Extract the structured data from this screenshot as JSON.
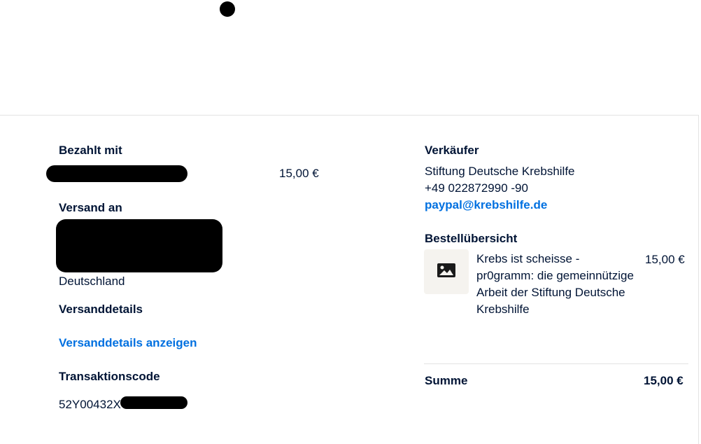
{
  "payment": {
    "heading": "Bezahlt mit",
    "amount": "15,00 €"
  },
  "shipping": {
    "heading": "Versand an",
    "country": "Deutschland"
  },
  "shipping_details": {
    "heading": "Versanddetails",
    "link_label": "Versanddetails anzeigen"
  },
  "transaction": {
    "heading": "Transaktionscode",
    "code_visible": "52Y00432X"
  },
  "seller": {
    "heading": "Verkäufer",
    "name": "Stiftung Deutsche Krebshilfe",
    "phone": "+49 022872990 -90",
    "email": "paypal@krebshilfe.de"
  },
  "order": {
    "heading": "Bestellübersicht",
    "item_image_icon": "image-placeholder-icon",
    "item_description": "Krebs ist scheisse - pr0gramm: die gemeinnützige Arbeit der Stiftung Deutsche Krebshilfe",
    "item_price": "15,00 €",
    "total_label": "Summe",
    "total_value": "15,00 €"
  },
  "colors": {
    "text": "#001435",
    "link": "#0070e0",
    "thumb_bg": "#f5f3ef",
    "border": "#e3e3e3"
  }
}
